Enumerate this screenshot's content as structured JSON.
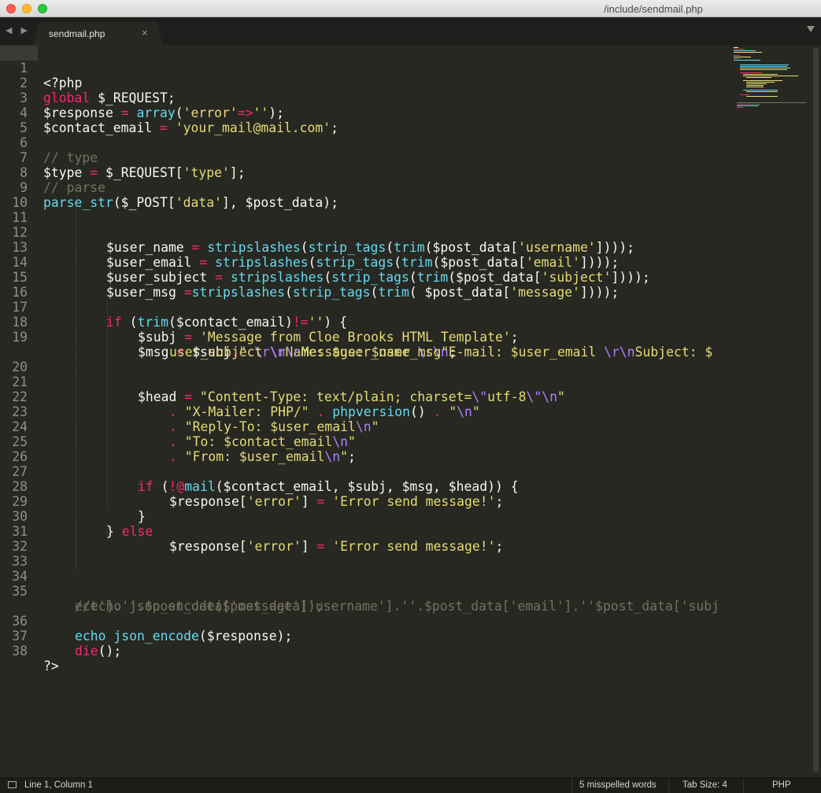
{
  "window": {
    "title": "/include/sendmail.php"
  },
  "nav": {
    "arrows": "◀ ▶"
  },
  "tabs": [
    {
      "label": "sendmail.php",
      "close": "×"
    }
  ],
  "editor": {
    "lines": [
      {
        "n": "1"
      },
      {
        "n": "2"
      },
      {
        "n": "3"
      },
      {
        "n": "4"
      },
      {
        "n": "5"
      },
      {
        "n": "6"
      },
      {
        "n": "7"
      },
      {
        "n": "8"
      },
      {
        "n": "9"
      },
      {
        "n": "10"
      },
      {
        "n": "11"
      },
      {
        "n": "12"
      },
      {
        "n": "13"
      },
      {
        "n": "14"
      },
      {
        "n": "15"
      },
      {
        "n": "16"
      },
      {
        "n": "17"
      },
      {
        "n": "18"
      },
      {
        "n": "19"
      },
      {
        "n": "20"
      },
      {
        "n": "21"
      },
      {
        "n": "22"
      },
      {
        "n": "23"
      },
      {
        "n": "24"
      },
      {
        "n": "25"
      },
      {
        "n": "26"
      },
      {
        "n": "27"
      },
      {
        "n": "28"
      },
      {
        "n": "29"
      },
      {
        "n": "30"
      },
      {
        "n": "31"
      },
      {
        "n": "32"
      },
      {
        "n": "33"
      },
      {
        "n": "34"
      },
      {
        "n": "35"
      },
      {
        "n": "36"
      },
      {
        "n": "37"
      },
      {
        "n": "38"
      }
    ],
    "code": {
      "l1": "<?php",
      "l2a": "global",
      "l2b": " $_REQUEST;",
      "l3a": "$response ",
      "l3b": "=",
      "l3c": " ",
      "l3d": "array",
      "l3e": "(",
      "l3f": "'error'",
      "l3g": "=>",
      "l3h": "''",
      "l3i": ");",
      "l4a": "$contact_email ",
      "l4b": "=",
      "l4c": " ",
      "l4d": "'your_mail@mail.com'",
      "l4e": ";",
      "l6": "// type",
      "l7a": "$type ",
      "l7b": "=",
      "l7c": " $_REQUEST[",
      "l7d": "'type'",
      "l7e": "];",
      "l8": "// parse",
      "l9a": "parse_str",
      "l9b": "($_POST[",
      "l9c": "'data'",
      "l9d": "], $post_data);",
      "l12a": "$user_name ",
      "l12b": "=",
      "l12c": " ",
      "l12d": "stripslashes",
      "l12e": "(",
      "l12f": "strip_tags",
      "l12g": "(",
      "l12h": "trim",
      "l12i": "($post_data[",
      "l12j": "'username'",
      "l12k": "])));",
      "l13a": "$user_email ",
      "l13b": "=",
      "l13c": " ",
      "l13d": "stripslashes",
      "l13e": "(",
      "l13f": "strip_tags",
      "l13g": "(",
      "l13h": "trim",
      "l13i": "($post_data[",
      "l13j": "'email'",
      "l13k": "])));",
      "l14a": "$user_subject ",
      "l14b": "=",
      "l14c": " ",
      "l14d": "stripslashes",
      "l14e": "(",
      "l14f": "strip_tags",
      "l14g": "(",
      "l14h": "trim",
      "l14i": "($post_data[",
      "l14j": "'subject'",
      "l14k": "])));",
      "l15a": "$user_msg ",
      "l15b": "=",
      "l15d": "stripslashes",
      "l15e": "(",
      "l15f": "strip_tags",
      "l15g": "(",
      "l15h": "trim",
      "l15i": "( $post_data[",
      "l15j": "'message'",
      "l15k": "])));",
      "l17a": "if",
      "l17b": " (",
      "l17c": "trim",
      "l17d": "($contact_email)",
      "l17e": "!=",
      "l17f": "''",
      "l17g": ") {",
      "l18a": "$subj ",
      "l18b": "=",
      "l18c": " ",
      "l18d": "'Message from Cloe Brooks HTML Template'",
      "l18e": ";",
      "l19a": "$msg ",
      "l19b": "=",
      "l19c": " $subj",
      "l19d": ".",
      "l19e": "\" ",
      "l19f": "\\r\\n",
      "l19g": "Name: $user_name ",
      "l19h": "\\r\\n",
      "l19i": "E-mail: $user_email ",
      "l19j": "\\r\\n",
      "l19k": "Subject: $",
      "l19wa": "user_subject ",
      "l19wb": "\\r\\n",
      "l19wc": "Message: $user_msg\"",
      "l19wd": ";",
      "l21a": "$head ",
      "l21b": "=",
      "l21c": " ",
      "l21d": "\"Content-Type: text/plain; charset=",
      "l21e": "\\\"",
      "l21f": "utf-8",
      "l21g": "\\\"",
      "l21h": "\\n",
      "l21i": "\"",
      "l22a": ".",
      "l22b": " ",
      "l22c": "\"X-Mailer: PHP/\"",
      "l22d": " ",
      "l22e": ".",
      "l22f": " ",
      "l22g": "phpversion",
      "l22h": "() ",
      "l22i": ".",
      "l22j": " ",
      "l22k": "\"",
      "l22l": "\\n",
      "l22m": "\"",
      "l23a": ".",
      "l23b": " ",
      "l23c": "\"Reply-To: $user_email",
      "l23d": "\\n",
      "l23e": "\"",
      "l24a": ".",
      "l24b": " ",
      "l24c": "\"To: $contact_email",
      "l24d": "\\n",
      "l24e": "\"",
      "l25a": ".",
      "l25b": " ",
      "l25c": "\"From: $user_email",
      "l25d": "\\n",
      "l25e": "\"",
      "l25f": ";",
      "l27a": "if",
      "l27b": " (",
      "l27c": "!",
      "l27d": "@",
      "l27e": "mail",
      "l27f": "($contact_email, $subj, $msg, $head)) {",
      "l28a": "$response[",
      "l28b": "'error'",
      "l28c": "] ",
      "l28d": "=",
      "l28e": " ",
      "l28f": "'Error send message!'",
      "l28g": ";",
      "l29": "}",
      "l30a": "} ",
      "l30b": "else",
      "l31a": "$response[",
      "l31b": "'error'",
      "l31c": "] ",
      "l31d": "=",
      "l31e": " ",
      "l31f": "'Error send message!'",
      "l31g": ";",
      "l35": "//echo json_encode($post_data['username'].''.$post_data['email'].''$post_data['subj",
      "l35w": "ect'].''.$post_data['message']);",
      "l36a": "echo",
      "l36b": " ",
      "l36c": "json_encode",
      "l36d": "($response);",
      "l37a": "die",
      "l37b": "();",
      "l38": "?>"
    }
  },
  "statusbar": {
    "position": "Line 1, Column 1",
    "spelling": "5 misspelled words",
    "tab_size": "Tab Size: 4",
    "syntax": "PHP"
  },
  "colors": {
    "background": "#272822",
    "keyword": "#f92672",
    "string": "#e6db74",
    "function": "#66d9ef",
    "comment": "#75715e",
    "escape": "#ae81ff"
  }
}
